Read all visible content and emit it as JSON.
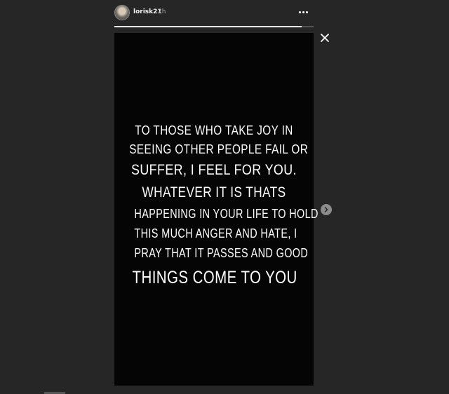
{
  "story": {
    "username": "lorisk21",
    "time_ago": "7h",
    "progress": 0.94,
    "lines": [
      "TO THOSE WHO TAKE JOY IN",
      "SEEING OTHER PEOPLE FAIL OR",
      "SUFFER, I FEEL FOR YOU.",
      "WHATEVER IT IS THATS",
      "HAPPENING IN YOUR LIFE TO HOLD",
      "THIS MUCH ANGER AND HATE, I",
      "PRAY THAT IT PASSES AND GOOD",
      "THINGS COME TO YOU"
    ]
  },
  "icons": {
    "close": "close-icon",
    "more": "more-options-icon",
    "next": "chevron-right-icon"
  },
  "colors": {
    "background": "#262626",
    "story_background": "#050505",
    "text": "#ffffff"
  }
}
